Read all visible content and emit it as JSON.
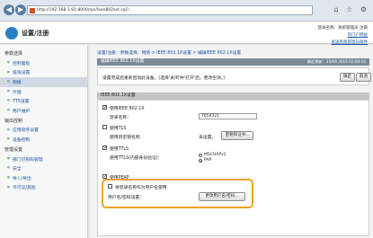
{
  "browser": {
    "url": "http://192.168.1.81:8000/rps/leee802set.cgi?...",
    "back_glyph": "◀",
    "forward_glyph": "▶",
    "toolbar_glyphs": "⌂ ☆ ⚙"
  },
  "header": {
    "title": "设置/注册",
    "link_portal": "到门户网站",
    "link_login": "登录名称：系统管理员 注销",
    "link_settings": "发送系统管理员邮件"
  },
  "sidebar": {
    "section_pref": "参数选择",
    "items_pref": [
      "控制面板",
      "纸张设置",
      "网络",
      "外围",
      "TTS设置",
      "用户维护"
    ],
    "active_index": 2,
    "section_output": "输出控制",
    "items_output": [
      "应用程序设置",
      "设备控制"
    ],
    "section_mgmt": "管理设置",
    "items_mgmt": [
      "部门识别码管理",
      "安全",
      "导入/导出",
      "许可证/其他"
    ]
  },
  "main": {
    "breadcrumb": "设置/注册：参数选择：网络 > IEEE 802.1X设置 > 编辑IEEE 802.1X设置",
    "bar_title": "编辑IEEE 802.1X设置",
    "last_update": "最近更新：25/09 2015 02:04:16",
    "note": "设置完成后重新启动此设备。(选择'关闭'并'打开'后，更改生效。)",
    "ok_label": "确定",
    "cancel_label": "取消",
    "section_title": "IEEE 802.1X设置",
    "use_ieee_label": "使用IEEE 802.1X",
    "login_name_label": "登录名称：",
    "login_name_value": "7654321",
    "use_tls_label": "使用TLS",
    "key_cert_label": "使用的密钥名称：",
    "key_cert_value": "未设置。",
    "key_cert_button": "密钥和证书...",
    "use_ttls_label": "使用TTLS",
    "ttls_internal_label": "使用TTLS(内部身份验证)：",
    "ttls_options": [
      "MSCHAPv2",
      "PAP"
    ],
    "ttls_selected": 1,
    "use_peap_label": "使用PEAP",
    "same_user_label": "将登录名称作为用户名使用",
    "user_pass_label": "用户名/密码设置：",
    "change_user_button": "更改用户名/密码..."
  },
  "colors": {
    "highlight": "#f0a32a",
    "bar": "#7d8a96",
    "link": "#1957a6"
  }
}
